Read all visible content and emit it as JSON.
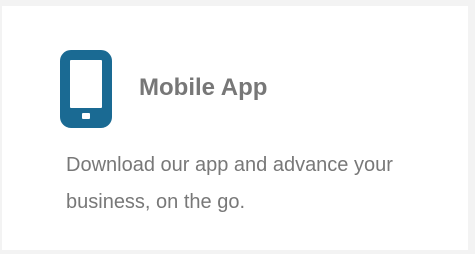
{
  "card": {
    "icon": "mobile-phone-icon",
    "accent_color": "#1a6a93",
    "title": "Mobile App",
    "description": "Download our app and advance your business, on the go."
  }
}
